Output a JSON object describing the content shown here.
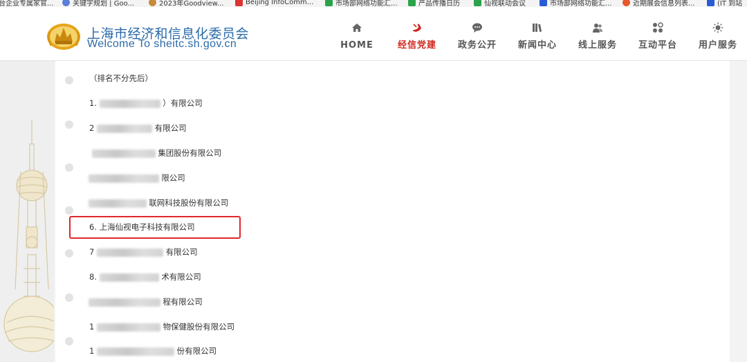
{
  "bookmarks": [
    {
      "label": "台企业专属家官...",
      "color": "#ffffff"
    },
    {
      "label": "关键字规划 | Goo...",
      "color": "#5a7fd8"
    },
    {
      "label": "2023年Goodview...",
      "color": "#c78a3a"
    },
    {
      "label": "Beijing InfoComm...",
      "color": "#d33"
    },
    {
      "label": "市场部网络功能汇...",
      "color": "#2aa34a"
    },
    {
      "label": "产品传播日历",
      "color": "#2aa34a"
    },
    {
      "label": "仙视联动会议",
      "color": "#2aa34a"
    },
    {
      "label": "市场部网络功能汇...",
      "color": "#2a5bd7"
    },
    {
      "label": "近期展会信息列表...",
      "color": "#e8562a"
    },
    {
      "label": "(IT 到站",
      "color": "#2a5bd7"
    }
  ],
  "site": {
    "title_cn": "上海市经济和信息化委员会",
    "title_en": "Welcome To sheitc.sh.gov.cn",
    "accent": "#2a6aa8"
  },
  "nav": [
    {
      "label": "HOME",
      "icon": "home-icon",
      "active": false
    },
    {
      "label": "经信党建",
      "icon": "party-emblem-icon",
      "active": true
    },
    {
      "label": "政务公开",
      "icon": "chat-bubble-icon",
      "active": false
    },
    {
      "label": "新闻中心",
      "icon": "books-icon",
      "active": false
    },
    {
      "label": "线上服务",
      "icon": "people-icon",
      "active": false
    },
    {
      "label": "互动平台",
      "icon": "grid-circles-icon",
      "active": false
    },
    {
      "label": "用户服务",
      "icon": "sun-icon",
      "active": false
    }
  ],
  "list": {
    "note": "（排名不分先后）",
    "items": [
      {
        "prefix": "1.",
        "suffix": "）有限公司"
      },
      {
        "prefix": "2",
        "suffix": "有限公司"
      },
      {
        "prefix": "",
        "suffix": "集团股份有限公司"
      },
      {
        "prefix": "",
        "suffix": "限公司"
      },
      {
        "prefix": "",
        "suffix": "联网科技股份有限公司"
      },
      {
        "prefix": "6.",
        "suffix": "上海仙视电子科技有限公司"
      },
      {
        "prefix": "7",
        "suffix": "有限公司"
      },
      {
        "prefix": "8.",
        "suffix": "术有限公司"
      },
      {
        "prefix": "",
        "suffix": "程有限公司"
      },
      {
        "prefix": "1",
        "suffix": "物保健股份有限公司"
      },
      {
        "prefix": "1",
        "suffix": "份有限公司"
      }
    ],
    "highlight_color": "#e0262a"
  }
}
